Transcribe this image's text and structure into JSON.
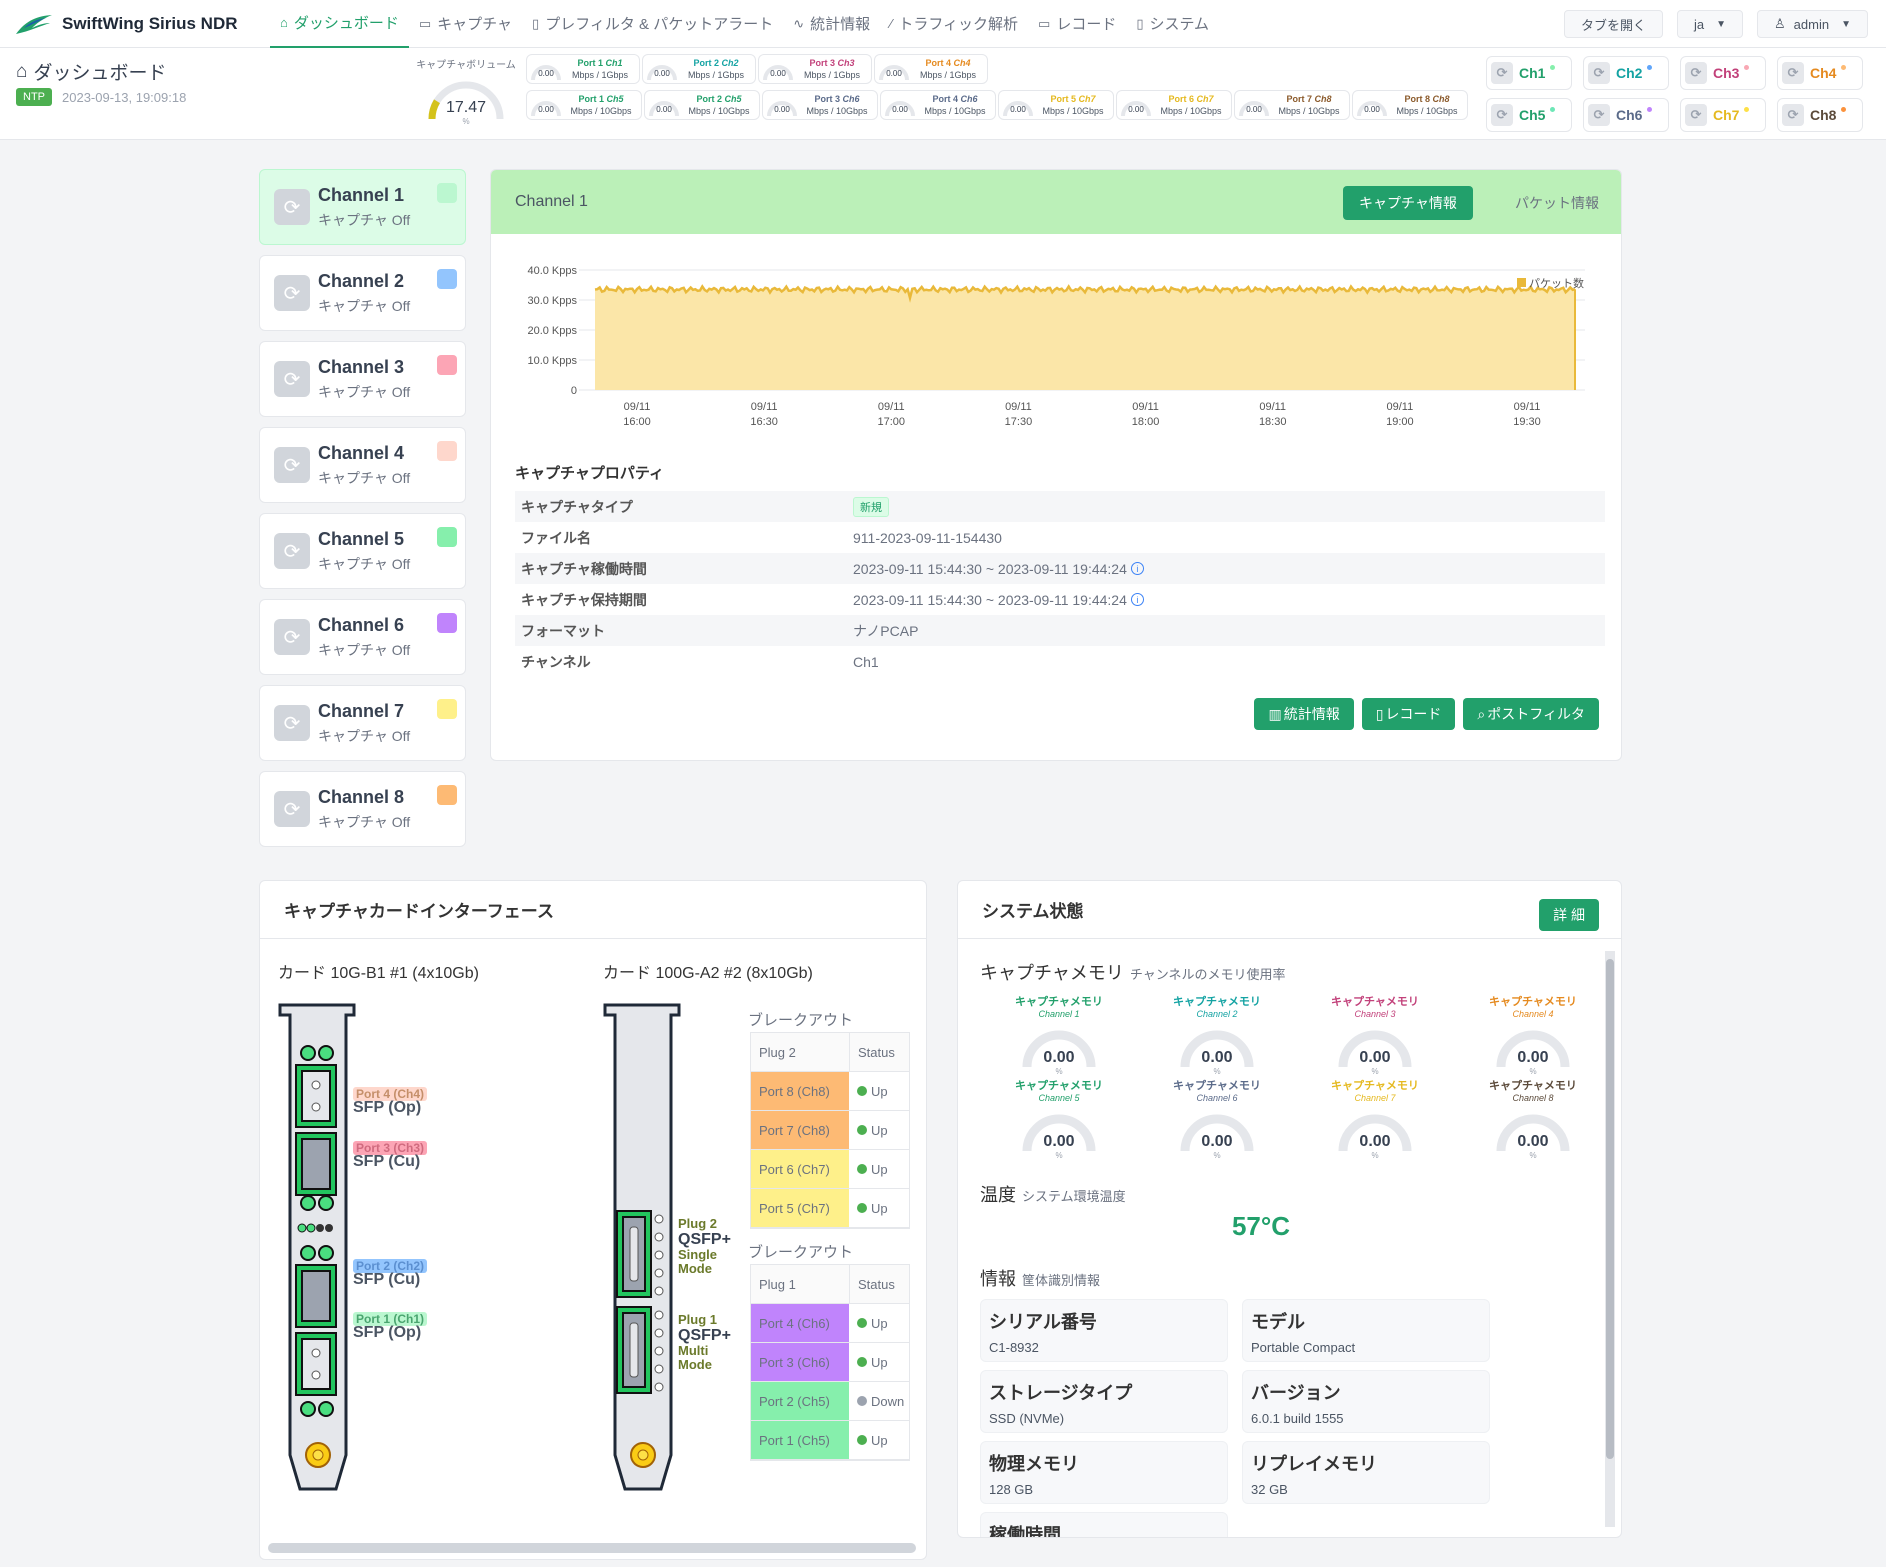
{
  "app": {
    "brand": "SwiftWing Sirius NDR"
  },
  "nav": {
    "items": [
      {
        "label": "ダッシュボード",
        "icon": "home-icon",
        "glyph": "⌂"
      },
      {
        "label": "キャプチャ",
        "icon": "camera-icon",
        "glyph": "▭"
      },
      {
        "label": "プレフィルタ & パケットアラート",
        "icon": "clipboard-icon",
        "glyph": "▯"
      },
      {
        "label": "統計情報",
        "icon": "activity-icon",
        "glyph": "∿"
      },
      {
        "label": "トラフィック解析",
        "icon": "wand-icon",
        "glyph": "⁄"
      },
      {
        "label": "レコード",
        "icon": "folder-icon",
        "glyph": "▭"
      },
      {
        "label": "システム",
        "icon": "clipboard-icon",
        "glyph": "▯"
      }
    ],
    "open_tab": "タブを開く",
    "lang": "ja",
    "user": "admin"
  },
  "header": {
    "title": "ダッシュボード",
    "ntp_label": "NTP",
    "datetime": "2023-09-13, 19:09:18",
    "volume_label": "キャプチャボリューム",
    "volume_value": "17.47",
    "volume_unit": "%",
    "volume_fraction": 0.1747,
    "ports_row1": [
      {
        "port": "Port 1",
        "ch": "Ch1",
        "unit": "Mbps / 1Gbps",
        "value": "0.00",
        "color": "#22a06b"
      },
      {
        "port": "Port 2",
        "ch": "Ch2",
        "unit": "Mbps / 1Gbps",
        "value": "0.00",
        "color": "#14a3a3"
      },
      {
        "port": "Port 3",
        "ch": "Ch3",
        "unit": "Mbps / 1Gbps",
        "value": "0.00",
        "color": "#c2417a"
      },
      {
        "port": "Port 4",
        "ch": "Ch4",
        "unit": "Mbps / 1Gbps",
        "value": "0.00",
        "color": "#e58a1f"
      }
    ],
    "ports_row2": [
      {
        "port": "Port 1",
        "ch": "Ch5",
        "unit": "Mbps / 10Gbps",
        "value": "0.00",
        "color": "#22a06b"
      },
      {
        "port": "Port 2",
        "ch": "Ch5",
        "unit": "Mbps / 10Gbps",
        "value": "0.00",
        "color": "#22a06b"
      },
      {
        "port": "Port 3",
        "ch": "Ch6",
        "unit": "Mbps / 10Gbps",
        "value": "0.00",
        "color": "#5b6b8a"
      },
      {
        "port": "Port 4",
        "ch": "Ch6",
        "unit": "Mbps / 10Gbps",
        "value": "0.00",
        "color": "#5b6b8a"
      },
      {
        "port": "Port 5",
        "ch": "Ch7",
        "unit": "Mbps / 10Gbps",
        "value": "0.00",
        "color": "#e5b91f"
      },
      {
        "port": "Port 6",
        "ch": "Ch7",
        "unit": "Mbps / 10Gbps",
        "value": "0.00",
        "color": "#e5b91f"
      },
      {
        "port": "Port 7",
        "ch": "Ch8",
        "unit": "Mbps / 10Gbps",
        "value": "0.00",
        "color": "#8b5a2b"
      },
      {
        "port": "Port 8",
        "ch": "Ch8",
        "unit": "Mbps / 10Gbps",
        "value": "0.00",
        "color": "#8b5a2b"
      }
    ],
    "ch_buttons": [
      {
        "label": "Ch1",
        "color": "#22a06b",
        "dot": "#86efac"
      },
      {
        "label": "Ch2",
        "color": "#14a3a3",
        "dot": "#60a5fa"
      },
      {
        "label": "Ch3",
        "color": "#c2417a",
        "dot": "#f9a8b4"
      },
      {
        "label": "Ch4",
        "color": "#e58a1f",
        "dot": "#fdba74"
      },
      {
        "label": "Ch5",
        "color": "#22a06b",
        "dot": "#6ee7b7"
      },
      {
        "label": "Ch6",
        "color": "#5b6b8a",
        "dot": "#c084fc"
      },
      {
        "label": "Ch7",
        "color": "#e5b91f",
        "dot": "#fde047"
      },
      {
        "label": "Ch8",
        "color": "#5b4a3a",
        "dot": "#fb923c"
      }
    ]
  },
  "channels": [
    {
      "name": "Channel 1",
      "status": "キャプチャ Off",
      "color": "#bbf7d0",
      "active": true
    },
    {
      "name": "Channel 2",
      "status": "キャプチャ Off",
      "color": "#93c5fd",
      "active": false
    },
    {
      "name": "Channel 3",
      "status": "キャプチャ Off",
      "color": "#fca5b5",
      "active": false
    },
    {
      "name": "Channel 4",
      "status": "キャプチャ Off",
      "color": "#fed7cc",
      "active": false
    },
    {
      "name": "Channel 5",
      "status": "キャプチャ Off",
      "color": "#86efac",
      "active": false
    },
    {
      "name": "Channel 6",
      "status": "キャプチャ Off",
      "color": "#c084fc",
      "active": false
    },
    {
      "name": "Channel 7",
      "status": "キャプチャ Off",
      "color": "#fef08a",
      "active": false
    },
    {
      "name": "Channel 8",
      "status": "キャプチャ Off",
      "color": "#fdba74",
      "active": false
    }
  ],
  "main": {
    "title": "Channel 1",
    "tab_capture": "キャプチャ情報",
    "tab_packet": "パケット情報",
    "props_title": "キャプチャプロパティ",
    "props": [
      {
        "key": "キャプチャタイプ",
        "value": "新規",
        "badge": true
      },
      {
        "key": "ファイル名",
        "value": "911-2023-09-11-154430"
      },
      {
        "key": "キャプチャ稼働時間",
        "value": "2023-09-11 15:44:30 ~ 2023-09-11 19:44:24",
        "info": true
      },
      {
        "key": "キャプチャ保持期間",
        "value": "2023-09-11 15:44:30 ~ 2023-09-11 19:44:24",
        "info": true
      },
      {
        "key": "フォーマット",
        "value": "ナノPCAP"
      },
      {
        "key": "チャンネル",
        "value": "Ch1"
      }
    ],
    "btn_stats": "統計情報",
    "btn_record": "レコード",
    "btn_postfilter": "ポストフィルタ"
  },
  "chart_data": {
    "type": "area",
    "title": "",
    "legend": [
      "パケット数"
    ],
    "legend_position": "top-right",
    "ylabel": "",
    "y_ticks": [
      "40.0 Kpps",
      "30.0 Kpps",
      "20.0 Kpps",
      "10.0 Kpps",
      "0"
    ],
    "ylim": [
      0,
      40000
    ],
    "x_ticks": [
      [
        "09/11",
        "16:00"
      ],
      [
        "09/11",
        "16:30"
      ],
      [
        "09/11",
        "17:00"
      ],
      [
        "09/11",
        "17:30"
      ],
      [
        "09/11",
        "18:00"
      ],
      [
        "09/11",
        "18:30"
      ],
      [
        "09/11",
        "19:00"
      ],
      [
        "09/11",
        "19:30"
      ]
    ],
    "x_range": [
      "2023-09-11 15:44:30",
      "2023-09-11 19:44:24"
    ],
    "series": [
      {
        "name": "パケット数",
        "level_range": [
          32500,
          34500
        ],
        "color": "#e9b93a",
        "fill": "#fbe6a8"
      }
    ],
    "grid": true
  },
  "cards": {
    "title": "キャプチャカードインターフェース",
    "card1_label": "カード 10G-B1 #1 (4x10Gb)",
    "card2_label": "カード 100G-A2 #2 (8x10Gb)",
    "card1_ports": [
      {
        "tag": "Port 4 (Ch4)",
        "kind": "SFP (Op)",
        "color": "#fed7cc",
        "tagtext": "#c58f6a"
      },
      {
        "tag": "Port 3 (Ch3)",
        "kind": "SFP (Cu)",
        "color": "#fca5b5",
        "tagtext": "#d06b7f"
      },
      {
        "tag": "Port 2 (Ch2)",
        "kind": "SFP (Cu)",
        "color": "#93c5fd",
        "tagtext": "#5b8fd0"
      },
      {
        "tag": "Port 1 (Ch1)",
        "kind": "SFP (Op)",
        "color": "#bbf7d0",
        "tagtext": "#4aa56f"
      }
    ],
    "plug2_label": [
      "Plug 2",
      "QSFP+",
      "Single",
      "Mode"
    ],
    "plug1_label": [
      "Plug 1",
      "QSFP+",
      "Multi",
      "Mode"
    ],
    "breakout_title": "ブレークアウト",
    "breakout1": {
      "plug_header": "Plug 2",
      "status_header": "Status",
      "rows": [
        {
          "port": "Port 8 (Ch8)",
          "status": "Up",
          "color": "#fdba74",
          "dot": "#4caf50"
        },
        {
          "port": "Port 7 (Ch8)",
          "status": "Up",
          "color": "#fdba74",
          "dot": "#4caf50"
        },
        {
          "port": "Port 6 (Ch7)",
          "status": "Up",
          "color": "#fef08a",
          "dot": "#4caf50"
        },
        {
          "port": "Port 5 (Ch7)",
          "status": "Up",
          "color": "#fef08a",
          "dot": "#4caf50"
        }
      ]
    },
    "breakout2": {
      "plug_header": "Plug 1",
      "status_header": "Status",
      "rows": [
        {
          "port": "Port 4 (Ch6)",
          "status": "Up",
          "color": "#c084fc",
          "dot": "#4caf50"
        },
        {
          "port": "Port 3 (Ch6)",
          "status": "Up",
          "color": "#c084fc",
          "dot": "#4caf50"
        },
        {
          "port": "Port 2 (Ch5)",
          "status": "Down",
          "color": "#86efac",
          "dot": "#9ca3af"
        },
        {
          "port": "Port 1 (Ch5)",
          "status": "Up",
          "color": "#86efac",
          "dot": "#4caf50"
        }
      ]
    }
  },
  "system": {
    "title": "システム状態",
    "detail_btn": "詳 細",
    "mem_title": "キャプチャメモリ",
    "mem_sub": "チャンネルのメモリ使用率",
    "mem": [
      {
        "label": "キャプチャメモリ",
        "ch": "Channel 1",
        "value": "0.00",
        "unit": "%",
        "color": "#22a06b"
      },
      {
        "label": "キャプチャメモリ",
        "ch": "Channel 2",
        "value": "0.00",
        "unit": "%",
        "color": "#14a3a3"
      },
      {
        "label": "キャプチャメモリ",
        "ch": "Channel 3",
        "value": "0.00",
        "unit": "%",
        "color": "#c2417a"
      },
      {
        "label": "キャプチャメモリ",
        "ch": "Channel 4",
        "value": "0.00",
        "unit": "%",
        "color": "#e58a1f"
      },
      {
        "label": "キャプチャメモリ",
        "ch": "Channel 5",
        "value": "0.00",
        "unit": "%",
        "color": "#22a06b"
      },
      {
        "label": "キャプチャメモリ",
        "ch": "Channel 6",
        "value": "0.00",
        "unit": "%",
        "color": "#5b6b8a"
      },
      {
        "label": "キャプチャメモリ",
        "ch": "Channel 7",
        "value": "0.00",
        "unit": "%",
        "color": "#e5b91f"
      },
      {
        "label": "キャプチャメモリ",
        "ch": "Channel 8",
        "value": "0.00",
        "unit": "%",
        "color": "#5b4a3a"
      }
    ],
    "temp_title": "温度",
    "temp_sub": "システム環境温度",
    "temp_value": "57°C",
    "info_title": "情報",
    "info_sub": "筐体識別情報",
    "info": [
      {
        "key": "シリアル番号",
        "value": "C1-8932"
      },
      {
        "key": "モデル",
        "value": "Portable Compact"
      },
      {
        "key": "ストレージタイプ",
        "value": "SSD (NVMe)"
      },
      {
        "key": "バージョン",
        "value": "6.0.1 build 1555"
      },
      {
        "key": "物理メモリ",
        "value": "128 GB"
      },
      {
        "key": "リプレイメモリ",
        "value": "32 GB"
      },
      {
        "key": "稼働時間",
        "value": ""
      }
    ]
  }
}
